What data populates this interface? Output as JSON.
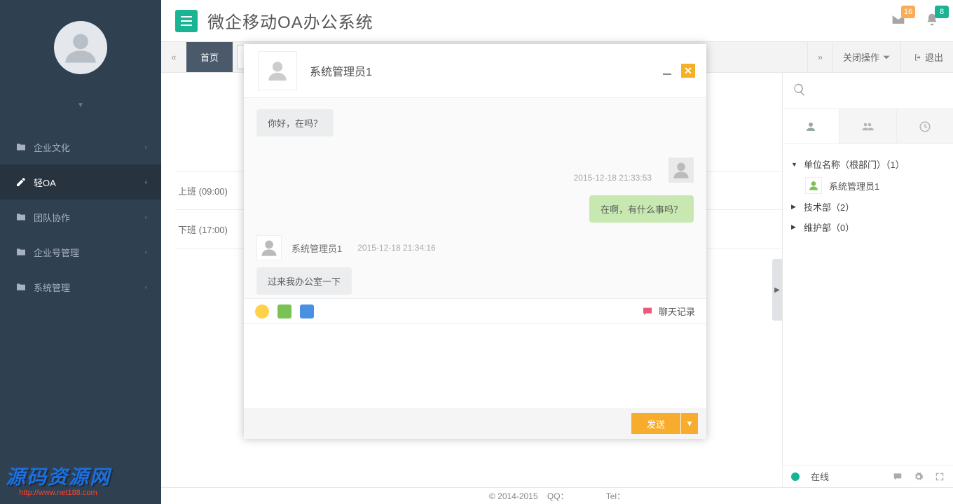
{
  "app_title": "微企移动OA办公系统",
  "sidebar": {
    "items": [
      {
        "label": "企业文化"
      },
      {
        "label": "轻OA"
      },
      {
        "label": "团队协作"
      },
      {
        "label": "企业号管理"
      },
      {
        "label": "系统管理"
      }
    ]
  },
  "notifications": {
    "mail": "16",
    "bell": "8"
  },
  "tabs": {
    "home": "首页",
    "close_ops": "关闭操作",
    "logout": "退出"
  },
  "main_rows": {
    "row1": "上班 (09:00)",
    "row2": "下班 (17:00)"
  },
  "chat": {
    "title": "系统管理员1",
    "msg1": "你好，在吗？",
    "ts1": "2015-12-18 21:33:53",
    "msg2": "在啊，有什么事吗？",
    "sender3": "系统管理员1",
    "ts3": "2015-12-18 21:34:16",
    "msg3": "过来我办公室一下",
    "history_label": "聊天记录",
    "send_label": "发送"
  },
  "tree": {
    "root": "单位名称（根部门）（1）",
    "user1": "系统管理员1",
    "dept2": "技术部（2）",
    "dept3": "维护部（0）"
  },
  "status_bar": {
    "online": "在线"
  },
  "footer": {
    "copy": "© 2014-2015",
    "qq": "QQ：",
    "tel": "Tel："
  },
  "watermark": {
    "main": "源码资源网",
    "sub": "http://www.net188.com"
  }
}
